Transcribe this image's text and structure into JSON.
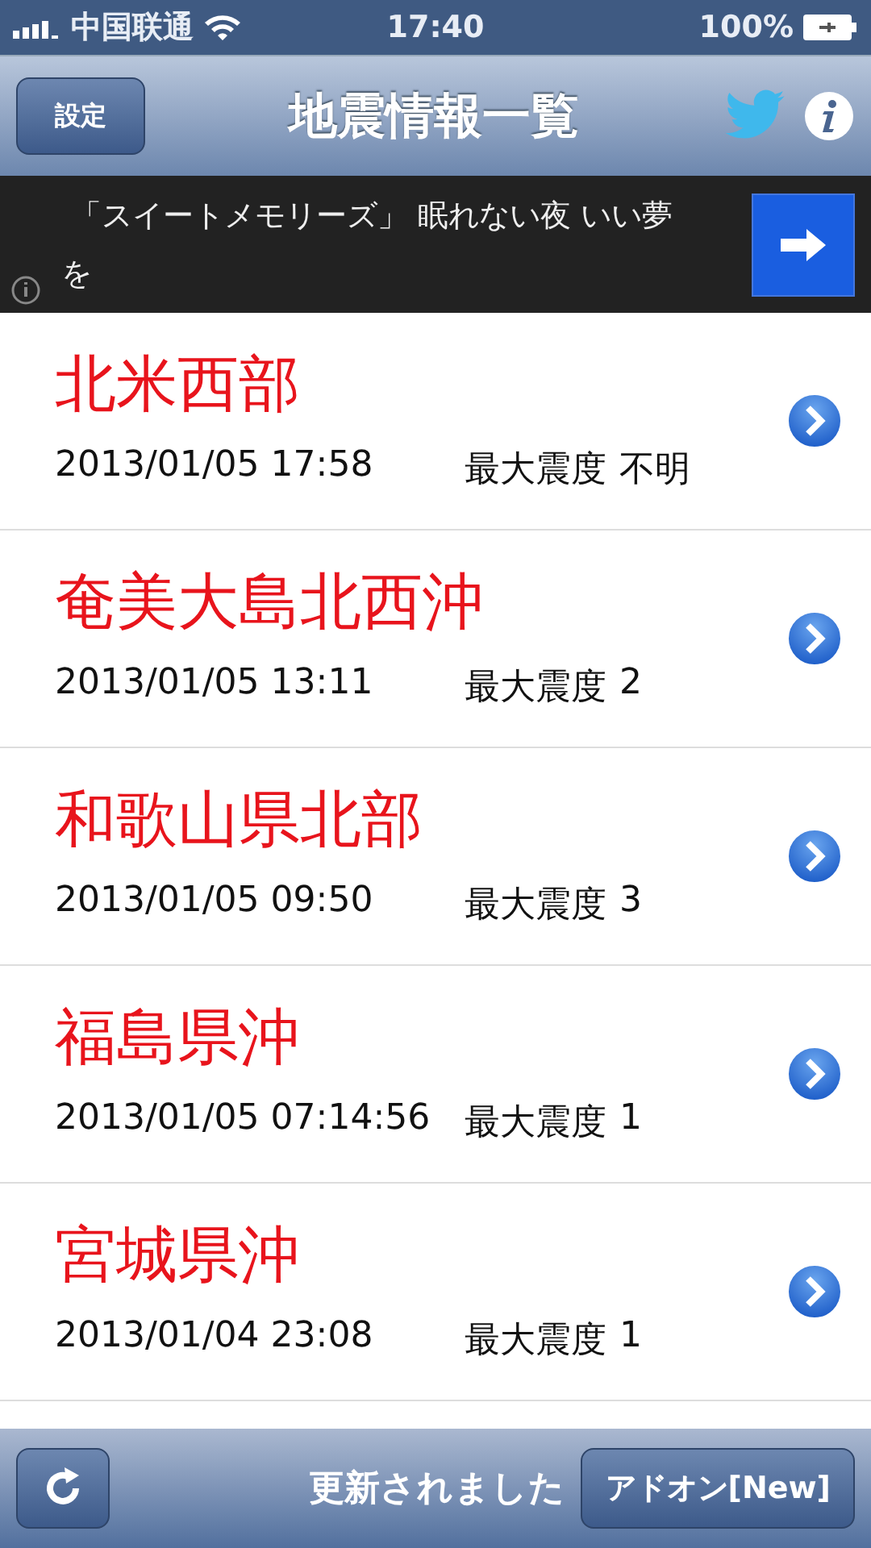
{
  "status_bar": {
    "carrier": "中国联通",
    "time": "17:40",
    "battery": "100%"
  },
  "nav": {
    "left_button": "設定",
    "title": "地震情報一覧"
  },
  "ad": {
    "text": "「スイートメモリーズ」 眠れない夜 いい夢を"
  },
  "quakes": [
    {
      "place": "北米西部",
      "datetime": "2013/01/05 17:58",
      "intensity_label": "最大震度",
      "intensity": "不明"
    },
    {
      "place": "奄美大島北西沖",
      "datetime": "2013/01/05 13:11",
      "intensity_label": "最大震度",
      "intensity": "2"
    },
    {
      "place": "和歌山県北部",
      "datetime": "2013/01/05 09:50",
      "intensity_label": "最大震度",
      "intensity": "3"
    },
    {
      "place": "福島県沖",
      "datetime": "2013/01/05 07:14:56",
      "intensity_label": "最大震度",
      "intensity": "1"
    },
    {
      "place": "宮城県沖",
      "datetime": "2013/01/04 23:08",
      "intensity_label": "最大震度",
      "intensity": "1"
    }
  ],
  "toolbar": {
    "status": "更新されました",
    "addon_button": "アドオン[New]"
  }
}
